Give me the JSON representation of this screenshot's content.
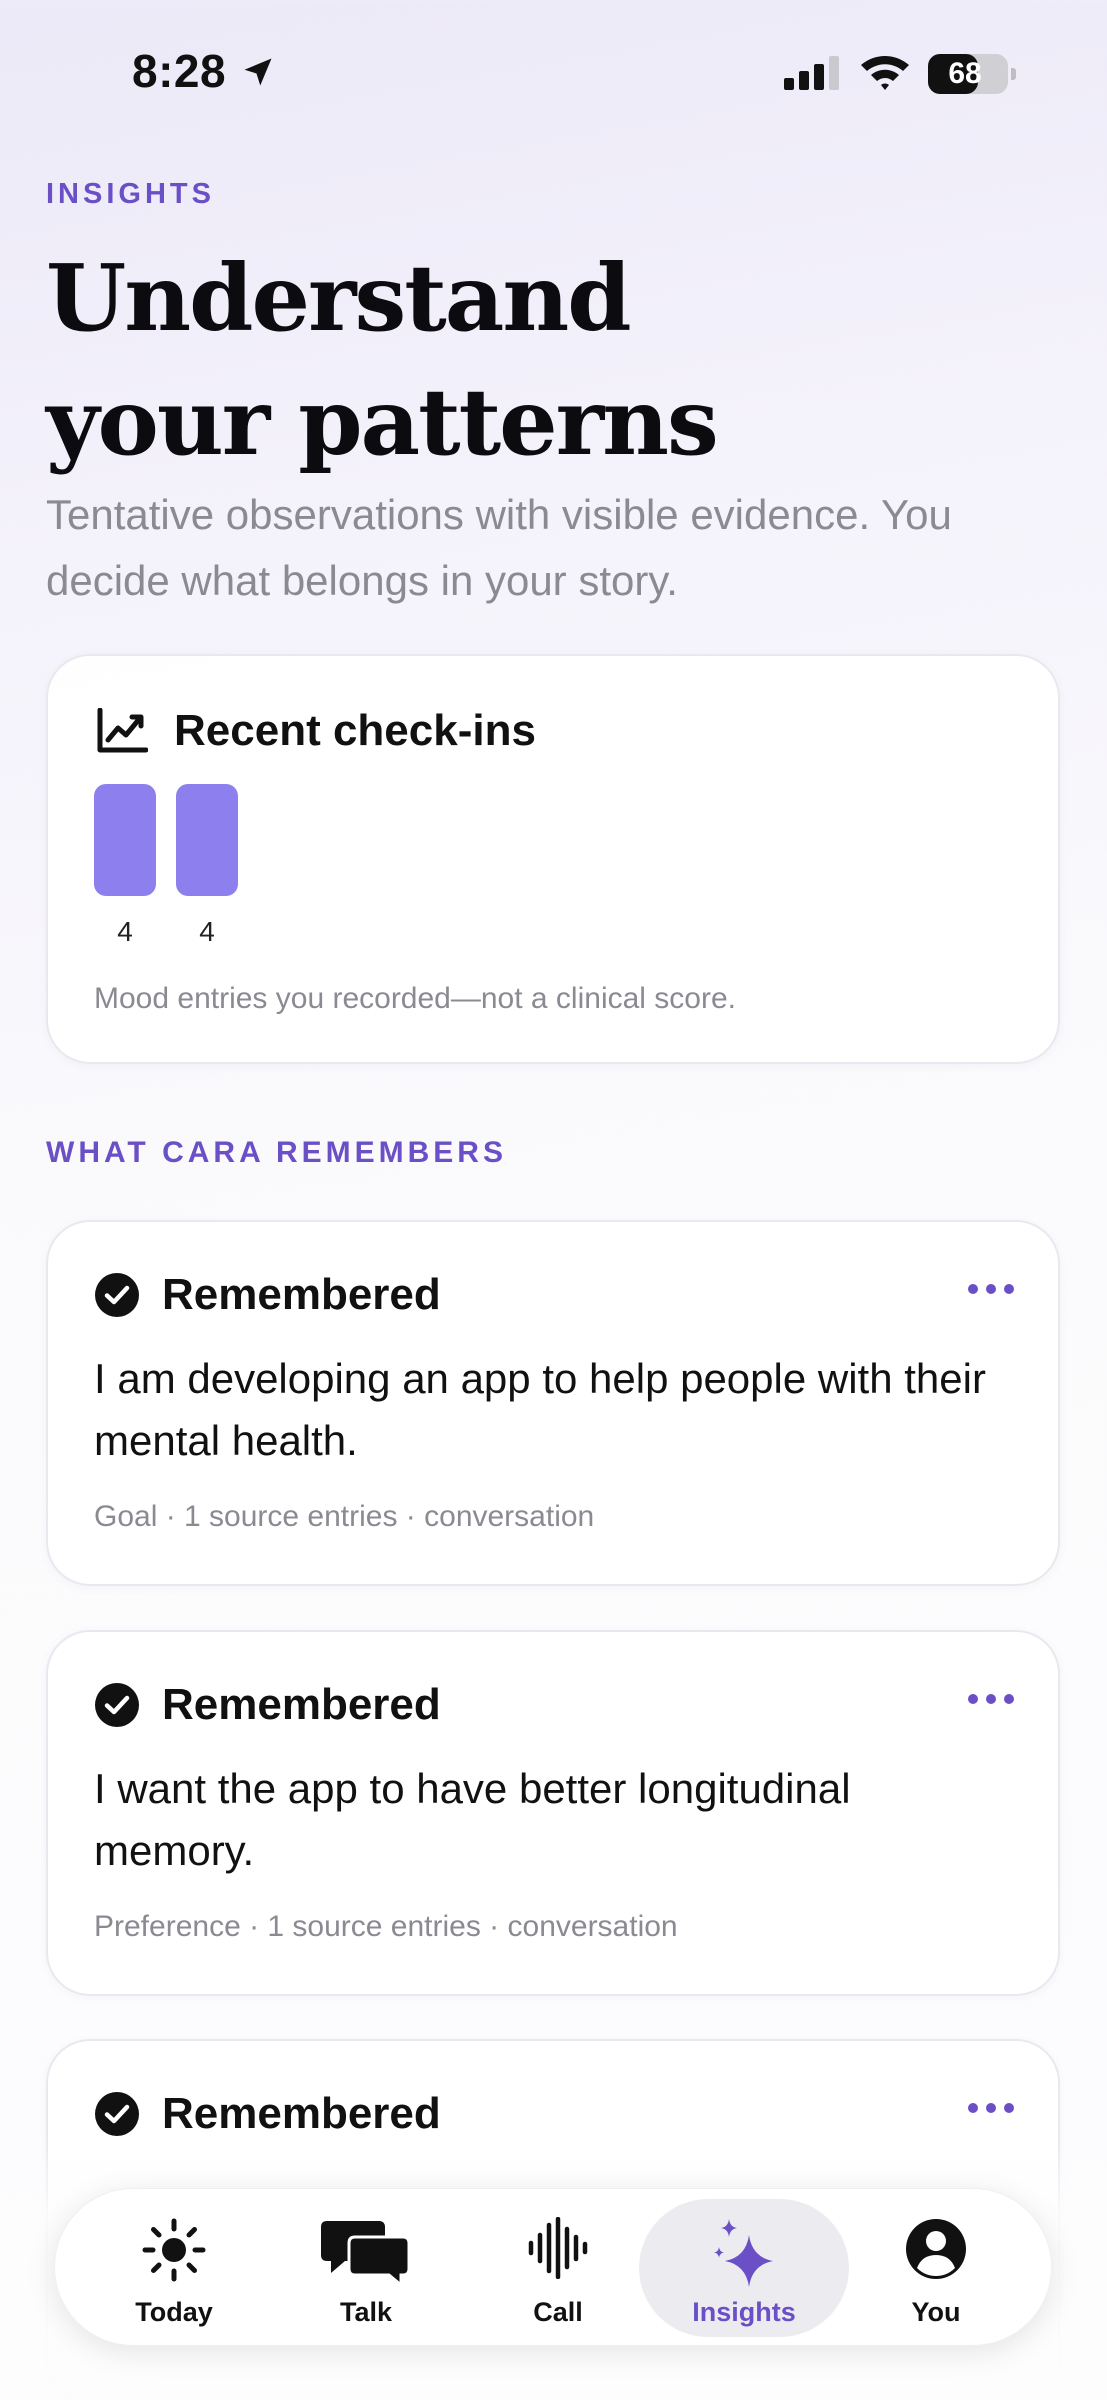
{
  "status_bar": {
    "time": "8:28",
    "battery": "68",
    "battery_level": 0.68
  },
  "header": {
    "eyebrow": "INSIGHTS",
    "title": "Understand your patterns",
    "subtitle": "Tentative observations with visible evidence. You decide what belongs in your story."
  },
  "checkins": {
    "title": "Recent check-ins",
    "bars": [
      {
        "value": 4,
        "label": "4"
      },
      {
        "value": 4,
        "label": "4"
      }
    ],
    "caption": "Mood entries you recorded—not a clinical score."
  },
  "memories": {
    "section_label": "WHAT CARA REMEMBERS",
    "items": [
      {
        "status": "Remembered",
        "text": "I am developing an app to help people with their mental health.",
        "meta": "Goal · 1 source entries · conversation"
      },
      {
        "status": "Remembered",
        "text": "I want the app to have better longitudinal memory.",
        "meta": "Preference · 1 source entries · conversation"
      },
      {
        "status": "Remembered",
        "text": "",
        "meta": ""
      }
    ]
  },
  "tabs": {
    "items": [
      {
        "label": "Today",
        "icon": "sun-icon"
      },
      {
        "label": "Talk",
        "icon": "chat-bubbles-icon"
      },
      {
        "label": "Call",
        "icon": "waveform-icon"
      },
      {
        "label": "Insights",
        "icon": "sparkles-icon",
        "active": true
      },
      {
        "label": "You",
        "icon": "person-circle-icon"
      }
    ]
  },
  "colors": {
    "accent": "#6a4fc6",
    "bar": "#8d80ee",
    "muted_text": "#8b8a92"
  }
}
